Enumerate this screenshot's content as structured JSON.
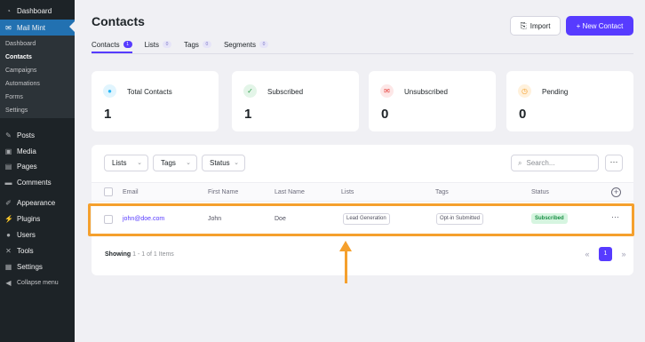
{
  "sidebar": {
    "top_items": [
      {
        "label": "Dashboard",
        "icon": "dashboard-icon"
      },
      {
        "label": "Mail Mint",
        "icon": "mail-icon"
      }
    ],
    "submenu": [
      "Dashboard",
      "Contacts",
      "Campaigns",
      "Automations",
      "Forms",
      "Settings"
    ],
    "current_sub": "Contacts",
    "items": [
      {
        "label": "Posts",
        "icon": "pin-icon"
      },
      {
        "label": "Media",
        "icon": "media-icon"
      },
      {
        "label": "Pages",
        "icon": "pages-icon"
      },
      {
        "label": "Comments",
        "icon": "comment-icon"
      },
      {
        "label": "Appearance",
        "icon": "brush-icon"
      },
      {
        "label": "Plugins",
        "icon": "plugin-icon"
      },
      {
        "label": "Users",
        "icon": "users-icon"
      },
      {
        "label": "Tools",
        "icon": "wrench-icon"
      },
      {
        "label": "Settings",
        "icon": "settings-icon"
      },
      {
        "label": "Collapse menu",
        "icon": "collapse-icon"
      }
    ]
  },
  "header": {
    "title": "Contacts",
    "import_label": "Import",
    "new_contact_label": "+ New Contact",
    "tabs": [
      {
        "label": "Contacts",
        "count": "1"
      },
      {
        "label": "Lists",
        "count": "0"
      },
      {
        "label": "Tags",
        "count": "0"
      },
      {
        "label": "Segments",
        "count": "0"
      }
    ]
  },
  "stats": [
    {
      "label": "Total Contacts",
      "value": "1",
      "icon": "contacts-icon",
      "color": "#29b6f6"
    },
    {
      "label": "Subscribed",
      "value": "1",
      "icon": "subscribed-icon",
      "color": "#2e9c4a"
    },
    {
      "label": "Unsubscribed",
      "value": "0",
      "icon": "unsubscribed-icon",
      "color": "#e53935"
    },
    {
      "label": "Pending",
      "value": "0",
      "icon": "pending-icon",
      "color": "#f5a02d"
    }
  ],
  "filters": {
    "lists": "Lists",
    "tags": "Tags",
    "status": "Status",
    "search_placeholder": "Search..."
  },
  "table": {
    "columns": [
      "Email",
      "First Name",
      "Last Name",
      "Lists",
      "Tags",
      "Status"
    ],
    "rows": [
      {
        "email": "john@doe.com",
        "first_name": "John",
        "last_name": "Doe",
        "list": "Lead Generation",
        "tag": "Opt-in Submitted",
        "status": "Subscribed"
      }
    ]
  },
  "footer": {
    "showing_label": "Showing",
    "showing_range": "1 - 1 of 1 Items",
    "current_page": "1"
  },
  "colors": {
    "accent": "#573bff",
    "highlight": "#f5a02d",
    "sidebar": "#1d2327",
    "wp_blue": "#2271b1"
  }
}
